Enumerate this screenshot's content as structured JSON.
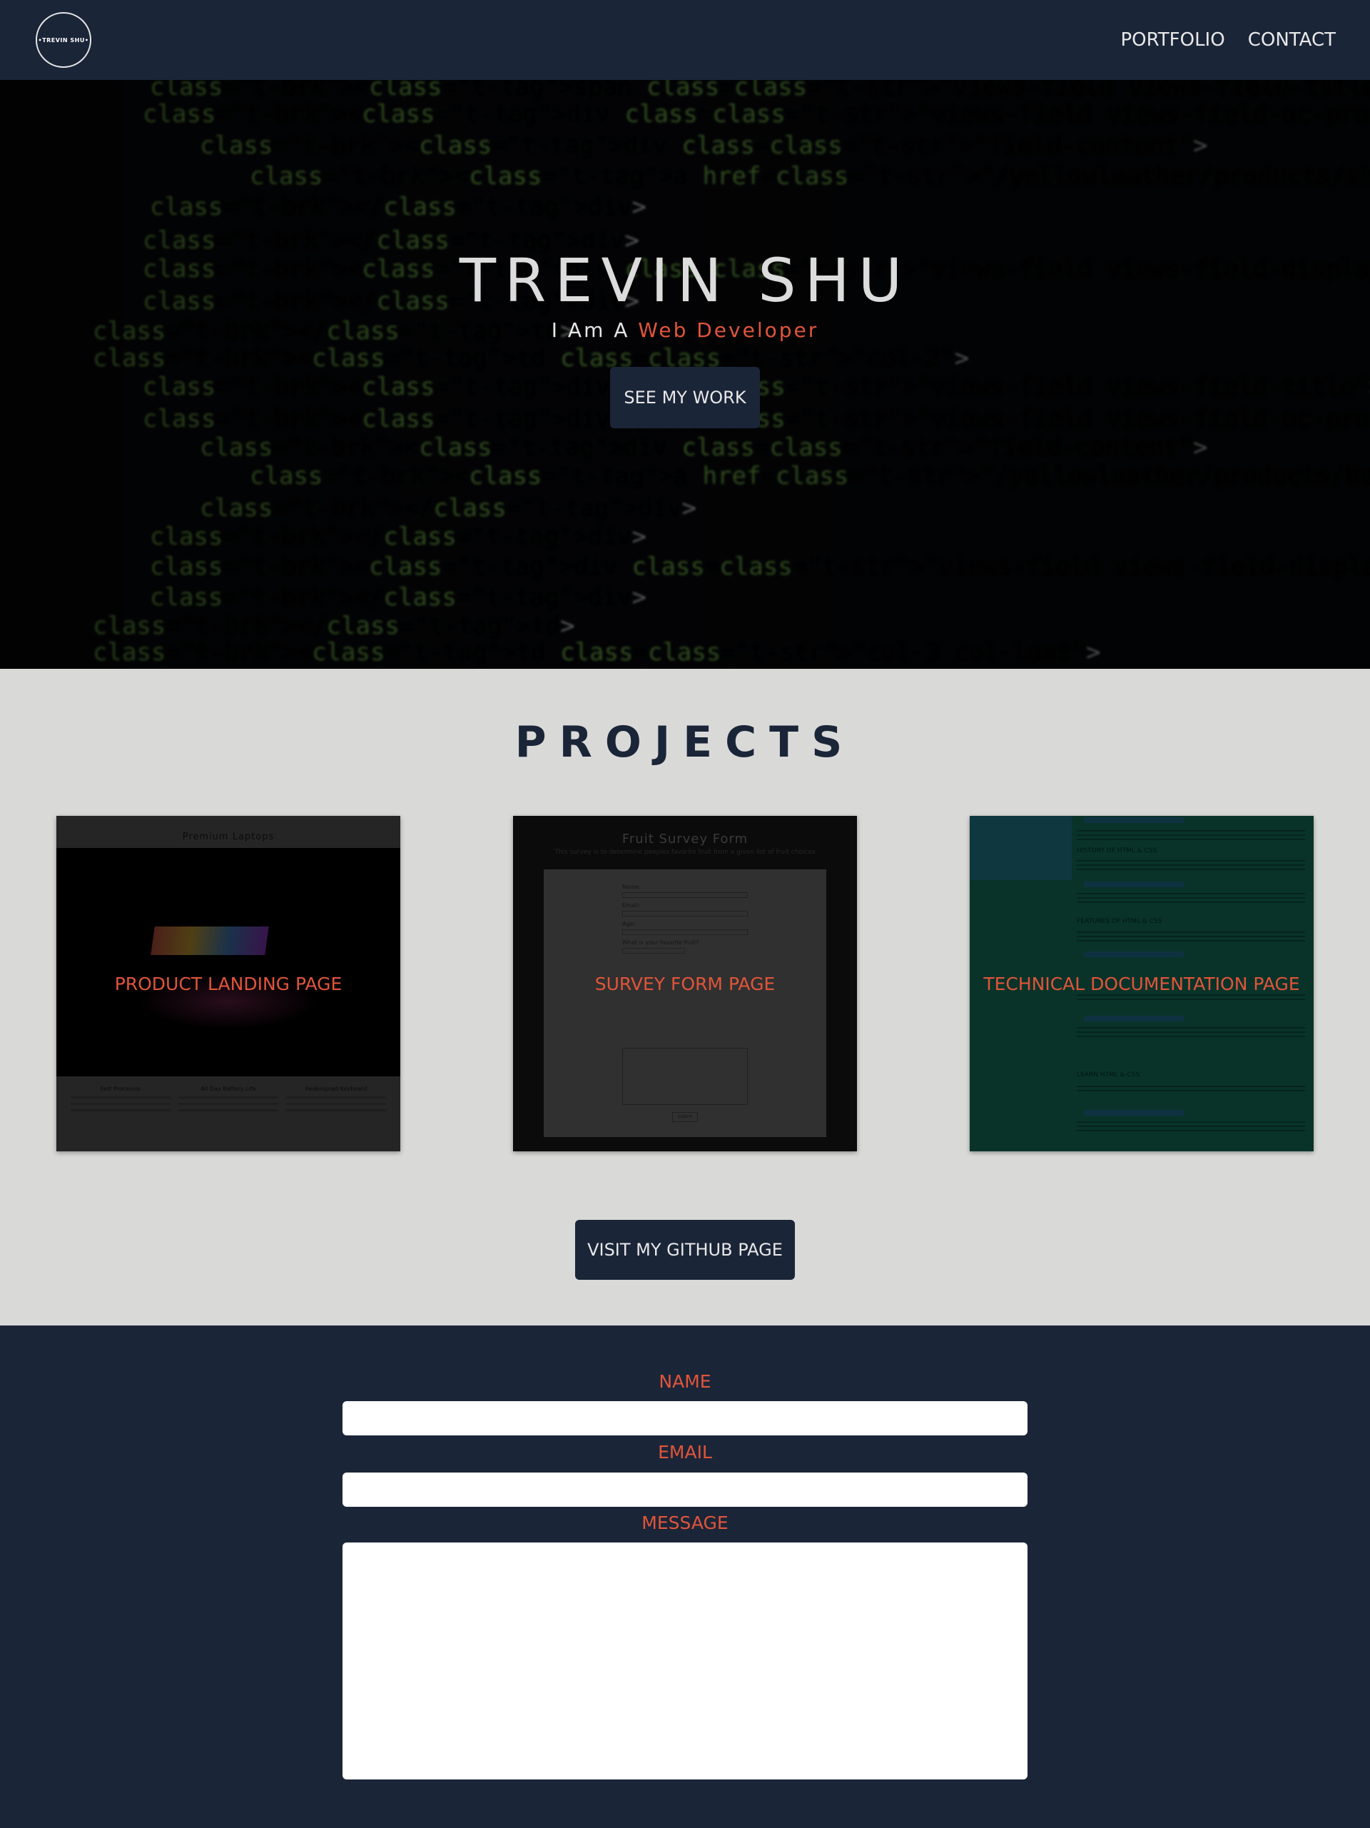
{
  "nav": {
    "logo_text": "•TREVIN SHU•",
    "links": [
      {
        "label": "PORTFOLIO"
      },
      {
        "label": "CONTACT"
      }
    ]
  },
  "hero": {
    "title": "TREVIN SHU",
    "subtitle_prefix": "I Am A ",
    "subtitle_accent": "Web Developer",
    "button_label": "SEE MY WORK",
    "code_lines": [
      "<span class=\"views-field views-field-title\"> <span class=\"field-content\"><a href=\"/yellowleather/products/",
      "<div class=\"views-field views-field-uc-product-image\">",
      "<div class=\"field-content\">",
      "<a href=\"/yellowleather/products/shoes/comfy-leather-shoes\"><img typeof=\"foaf:Image\" src=\"http://",
      "</div>",
      "</div>",
      "<div class=\"views-field views-field-display-price\"> <span class=\"views-label views-label-display-price\"",
      "</div>",
      "</td>",
      "<td class=\"col-2\">",
      "<div class=\"views-field views-field-title\"> <span class=\"field-content\"><a href=\"/yellowleather/products/",
      "<div class=\"views-field views-field-uc-product-image\">",
      "<div class=\"field-content\">",
      "<a href=\"/yellowleather/products/belts/embossed-spread-wing-eagle-belt\"><img typeof=\"foaf:Image\"",
      "</div>",
      "</div>",
      "<div class=\"views-field views-field-display-price\"> <span class=\"views-label views-label-display-price\"",
      "</div>",
      "</td>",
      "<td class=\"col-3 col-last\">",
      "<div class=\"views-field views-field-title\"> <span class=\"field-content\"><a href=\"/yellowleather/products/"
    ]
  },
  "projects": {
    "title": "PROJECTS",
    "cards": [
      {
        "label": "PRODUCT LANDING PAGE",
        "preview_title": "Premium Laptops",
        "features": [
          "Fast Processor",
          "All Day Battery Life",
          "Redesigned Keyboard"
        ]
      },
      {
        "label": "SURVEY FORM PAGE",
        "preview_title": "Fruit Survey Form",
        "preview_subtitle": "This survey is to determine peoples favorite fruit from a given list of fruit choices",
        "preview_fields": [
          "Name:",
          "Email:",
          "Age:",
          "What is your favorite fruit?"
        ],
        "preview_submit": "Submit"
      },
      {
        "label": "TECHNICAL DOCUMENTATION PAGE",
        "preview_headings": [
          "HISTORY OF HTML & CSS",
          "FEATURES OF HTML & CSS",
          "LEARN HTML & CSS"
        ]
      }
    ],
    "github_button_label": "VISIT MY GITHUB PAGE"
  },
  "contact": {
    "name_label": "NAME",
    "email_label": "EMAIL",
    "message_label": "MESSAGE",
    "name_value": "",
    "email_value": "",
    "message_value": ""
  },
  "colors": {
    "navy": "#1b2538",
    "accent": "#e0553a",
    "light_bg": "#d9d9d7"
  }
}
